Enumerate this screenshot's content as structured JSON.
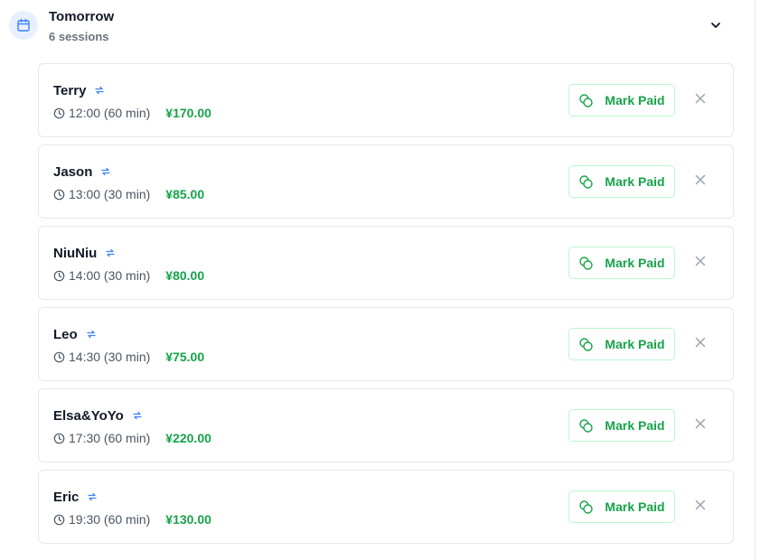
{
  "day": {
    "title": "Tomorrow",
    "subtitle": "6 sessions",
    "icon": "calendar-icon",
    "collapse_icon": "chevron-down-icon"
  },
  "colors": {
    "accent_green": "#16a34a",
    "accent_blue": "#3b82f6"
  },
  "mark_paid_label": "Mark Paid",
  "sessions": [
    {
      "name": "Terry",
      "time": "12:00 (60 min)",
      "price": "¥170.00"
    },
    {
      "name": "Jason",
      "time": "13:00 (30 min)",
      "price": "¥85.00"
    },
    {
      "name": "NiuNiu",
      "time": "14:00 (30 min)",
      "price": "¥80.00"
    },
    {
      "name": "Leo",
      "time": "14:30 (30 min)",
      "price": "¥75.00"
    },
    {
      "name": "Elsa&YoYo",
      "time": "17:30 (60 min)",
      "price": "¥220.00"
    },
    {
      "name": "Eric",
      "time": "19:30 (60 min)",
      "price": "¥130.00"
    }
  ]
}
